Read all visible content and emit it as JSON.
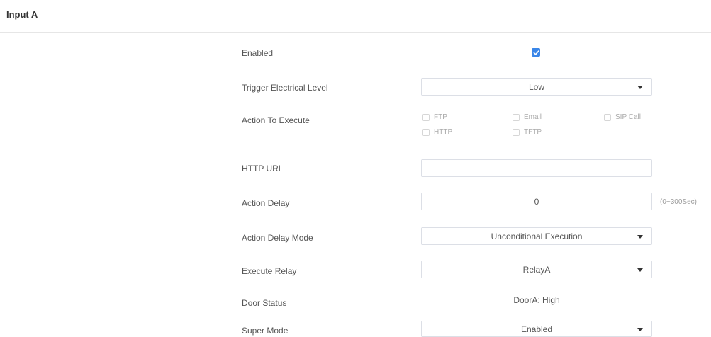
{
  "section": {
    "title": "Input A"
  },
  "rows": {
    "enabled": {
      "label": "Enabled",
      "checked": true
    },
    "trigger_level": {
      "label": "Trigger Electrical Level",
      "value": "Low"
    },
    "action_to_execute": {
      "label": "Action To Execute",
      "options": [
        {
          "label": "FTP",
          "checked": false
        },
        {
          "label": "Email",
          "checked": false
        },
        {
          "label": "SIP Call",
          "checked": false
        },
        {
          "label": "HTTP",
          "checked": false
        },
        {
          "label": "TFTP",
          "checked": false
        }
      ]
    },
    "http_url": {
      "label": "HTTP URL",
      "value": ""
    },
    "action_delay": {
      "label": "Action Delay",
      "value": "0",
      "hint": "(0~300Sec)"
    },
    "action_delay_mode": {
      "label": "Action Delay Mode",
      "value": "Unconditional Execution"
    },
    "execute_relay": {
      "label": "Execute Relay",
      "value": "RelayA"
    },
    "door_status": {
      "label": "Door Status",
      "value": "DoorA: High"
    },
    "super_mode": {
      "label": "Super Mode",
      "value": "Enabled"
    }
  },
  "colors": {
    "accent": "#3a86e8",
    "border": "#dcdfe6",
    "label_text": "#555555",
    "muted_text": "#aaaaaa"
  },
  "icons": {
    "checkbox_checked": "check-icon",
    "select_arrow": "caret-down-icon"
  }
}
